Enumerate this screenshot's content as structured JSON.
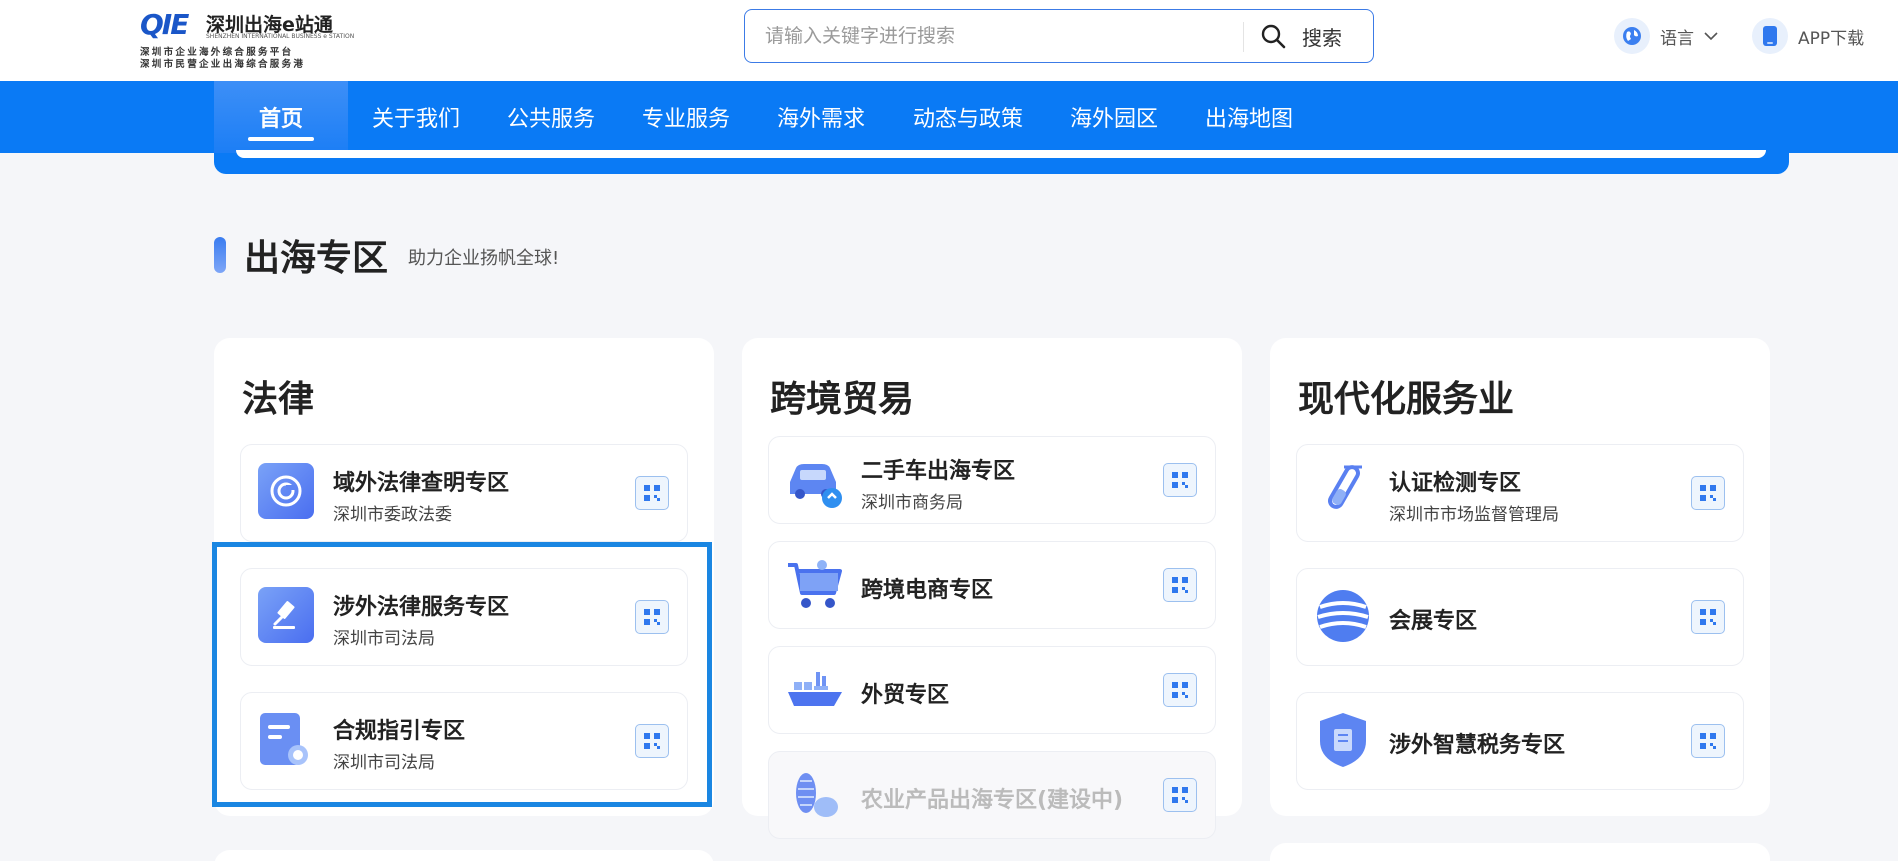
{
  "header": {
    "logo_mark": "QIE",
    "logo_title": "深圳出海e站通",
    "logo_subtitle": "SHENZHEN INTERNATIONAL BUSINESS e STATION",
    "logo_line1": "深圳市企业海外综合服务平台",
    "logo_line2": "深圳市民营企业出海综合服务港",
    "search_placeholder": "请输入关键字进行搜索",
    "search_button": "搜索",
    "language_label": "语言",
    "app_label": "APP下载"
  },
  "nav": {
    "items": [
      "首页",
      "关于我们",
      "公共服务",
      "专业服务",
      "海外需求",
      "动态与政策",
      "海外园区",
      "出海地图"
    ],
    "active_index": 0
  },
  "section": {
    "title": "出海专区",
    "subtitle": "助力企业扬帆全球!"
  },
  "columns": [
    {
      "title": "法律",
      "cards": [
        {
          "title": "域外法律查明专区",
          "subtitle": "深圳市委政法委",
          "icon": "legal-lookup-icon"
        },
        {
          "title": "涉外法律服务专区",
          "subtitle": "深圳市司法局",
          "icon": "gavel-icon"
        },
        {
          "title": "合规指引专区",
          "subtitle": "深圳市司法局",
          "icon": "certificate-document-icon"
        }
      ]
    },
    {
      "title": "跨境贸易",
      "cards": [
        {
          "title": "二手车出海专区",
          "subtitle": "深圳市商务局",
          "icon": "car-icon"
        },
        {
          "title": "跨境电商专区",
          "subtitle": "",
          "icon": "shopping-cart-icon"
        },
        {
          "title": "外贸专区",
          "subtitle": "",
          "icon": "cargo-ship-icon"
        },
        {
          "title": "农业产品出海专区(建设中)",
          "subtitle": "",
          "icon": "corn-icon",
          "disabled": true
        }
      ]
    },
    {
      "title": "现代化服务业",
      "cards": [
        {
          "title": "认证检测专区",
          "subtitle": "深圳市市场监督管理局",
          "icon": "test-tube-icon"
        },
        {
          "title": "会展专区",
          "subtitle": "",
          "icon": "globe-stripes-icon"
        },
        {
          "title": "涉外智慧税务专区",
          "subtitle": "",
          "icon": "tax-shield-icon"
        }
      ]
    }
  ],
  "colors": {
    "brand_blue": "#0a7af5",
    "highlight_border": "#1a86e2",
    "icon_gradient_start": "#7aa2f7",
    "icon_gradient_end": "#4a6ef0"
  }
}
